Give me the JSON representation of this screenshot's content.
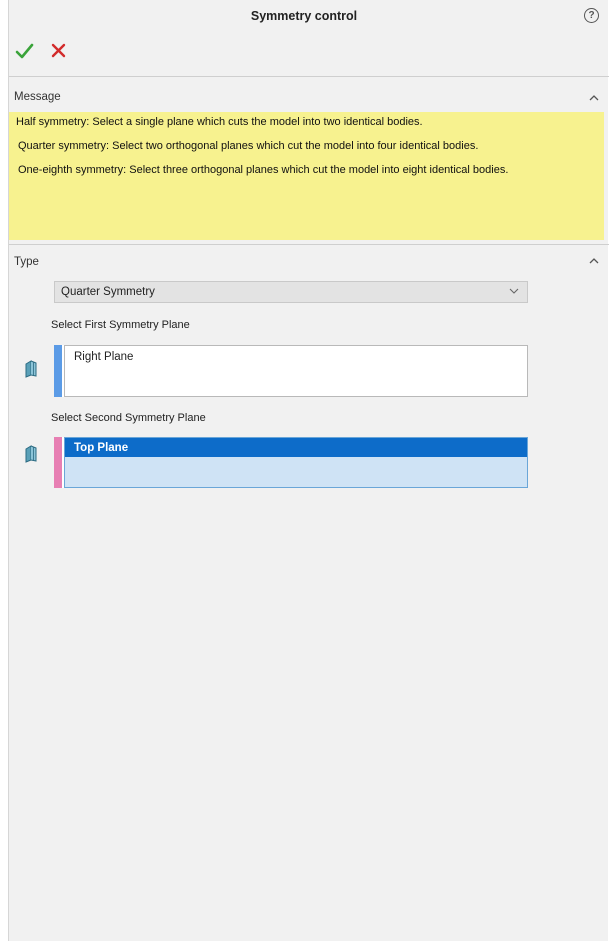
{
  "header": {
    "title": "Symmetry control",
    "help_icon": "help-icon",
    "help_glyph": "?"
  },
  "actions": {
    "ok_icon": "checkmark-icon",
    "cancel_icon": "close-icon",
    "ok_color": "#3aa33a",
    "cancel_color": "#d22b2b"
  },
  "message_section": {
    "title": "Message",
    "lines": [
      "Half symmetry: Select a single plane which cuts the model into two identical bodies.",
      "Quarter symmetry: Select two orthogonal planes which cut the model into four identical bodies.",
      "One-eighth symmetry: Select three orthogonal planes which cut the model into eight identical bodies."
    ],
    "background_color": "#f7f28f"
  },
  "type_section": {
    "title": "Type",
    "dropdown_value": "Quarter Symmetry",
    "first_plane": {
      "label": "Select First Symmetry Plane",
      "items": [
        "Right Plane"
      ],
      "bar_color": "#5b9be6"
    },
    "second_plane": {
      "label": "Select Second Symmetry Plane",
      "items": [
        "Top Plane"
      ],
      "bar_color": "#e77fb3"
    }
  }
}
